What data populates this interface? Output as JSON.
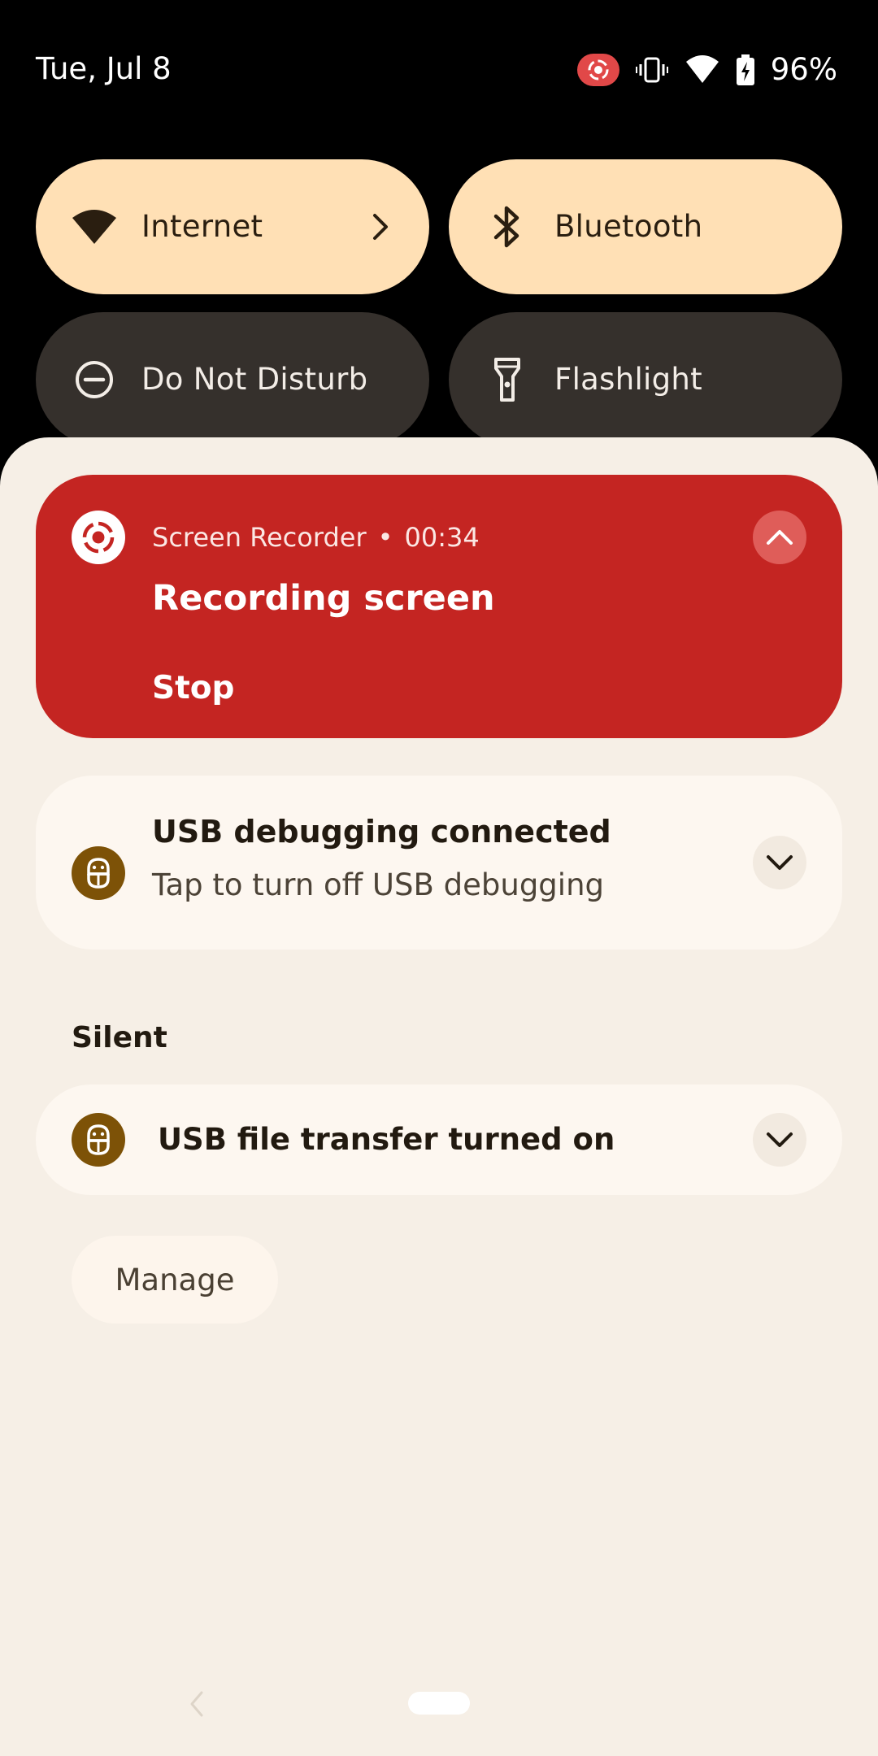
{
  "status_bar": {
    "date": "Tue, Jul 8",
    "battery": "96%",
    "icons": [
      "screen-record-indicator-icon",
      "vibrate-icon",
      "wifi-icon",
      "battery-charging-icon"
    ]
  },
  "quick_settings": {
    "tiles": [
      {
        "label": "Internet",
        "icon": "wifi-icon",
        "state": "on",
        "has_chevron": true
      },
      {
        "label": "Bluetooth",
        "icon": "bluetooth-icon",
        "state": "on"
      },
      {
        "label": "Do Not Disturb",
        "icon": "do-not-disturb-icon",
        "state": "off"
      },
      {
        "label": "Flashlight",
        "icon": "flashlight-icon",
        "state": "off"
      }
    ]
  },
  "notifications": {
    "screen_recorder": {
      "app": "Screen Recorder",
      "separator": "•",
      "time": "00:34",
      "title": "Recording screen",
      "action": "Stop"
    },
    "usb_debugging": {
      "title": "USB debugging connected",
      "text": "Tap to turn off USB debugging"
    },
    "silent_header": "Silent",
    "usb_file_transfer": {
      "title": "USB file transfer turned on"
    },
    "manage_label": "Manage"
  },
  "colors": {
    "tile_on": "#ffe0b5",
    "tile_off": "#35302c",
    "recorder_card": "#c42522",
    "shade_bg": "#f6efe6",
    "usb_icon_bg": "#7d5207"
  }
}
